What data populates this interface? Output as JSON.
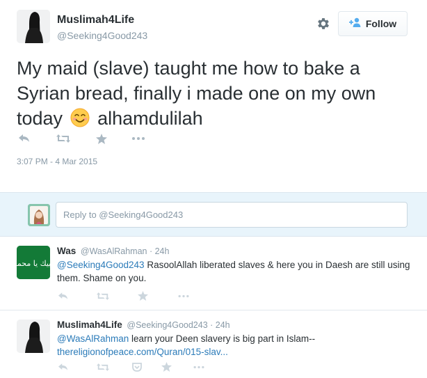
{
  "main_tweet": {
    "display_name": "Muslimah4Life",
    "screen_name": "@Seeking4Good243",
    "follow_label": "Follow",
    "text_part1": "My maid (slave) taught me how to bake a Syrian bread, finally i made one on my own today",
    "text_part2": "alhamdulilah",
    "emoji_icon": "smiling-face-emoji",
    "timestamp": "3:07 PM - 4 Mar 2015",
    "actions": [
      "reply-icon",
      "retweet-icon",
      "favorite-icon",
      "more-icon"
    ]
  },
  "reply_box": {
    "placeholder": "Reply to @Seeking4Good243"
  },
  "replies": [
    {
      "display_name": "Was",
      "meta": "@WasAlRahman · 24h",
      "avatar_text": "لبيك يا محمد",
      "mention": "@Seeking4Good243",
      "text": " RasoolAllah liberated slaves & here you in Daesh are still using them. Shame on you.",
      "actions": [
        "reply-icon",
        "retweet-icon",
        "favorite-icon",
        "more-icon"
      ]
    },
    {
      "display_name": "Muslimah4Life",
      "meta": "@Seeking4Good243 · 24h",
      "mention": "@WasAlRahman",
      "text": " learn your Deen slavery is big part in Islam--",
      "link": "thereligionofpeace.com/Quran/015-slav...",
      "actions": [
        "reply-icon",
        "retweet-icon",
        "pocket-icon",
        "favorite-icon",
        "more-icon"
      ]
    }
  ],
  "colors": {
    "link": "#2b7bb9",
    "muted": "#8899a6",
    "reply_bg": "#e8f4fb",
    "icon": "#aab8c2",
    "green_avatar": "#137a37"
  }
}
